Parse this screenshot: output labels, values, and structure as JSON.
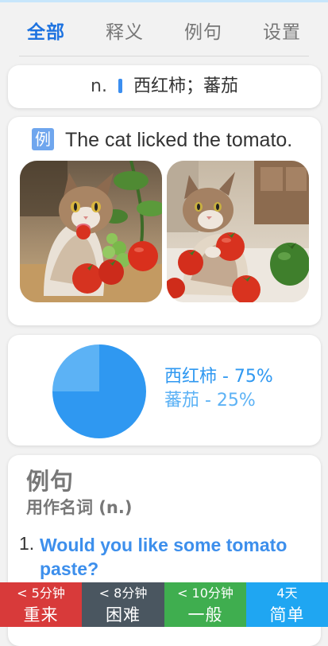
{
  "tabs": [
    {
      "label": "全部",
      "active": true
    },
    {
      "label": "释义",
      "active": false
    },
    {
      "label": "例句",
      "active": false
    },
    {
      "label": "设置",
      "active": false
    }
  ],
  "definition": {
    "pos": "n.",
    "meaning": "西红柿；蕃茄"
  },
  "example": {
    "badge": "例",
    "sentence": "The cat licked the tomato.",
    "images": [
      {
        "name": "kitten-licking-tomato-image"
      },
      {
        "name": "kitten-holding-tomato-image"
      }
    ]
  },
  "chart_data": {
    "type": "pie",
    "categories": [
      "西红柿",
      "蕃茄"
    ],
    "values": [
      75,
      25
    ],
    "labels": [
      "西红柿 - 75%",
      "蕃茄 - 25%"
    ],
    "colors": [
      "#2f98f1",
      "#5cb2f5"
    ],
    "legend_position": "right"
  },
  "usage": {
    "title": "例句",
    "subtitle": "用作名词 (n.)",
    "items": [
      {
        "number": "1.",
        "sentence": "Would you like some tomato paste?"
      }
    ]
  },
  "grades": [
    {
      "interval": "< 5分钟",
      "label": "重来",
      "color": "#d83a3a"
    },
    {
      "interval": "< 8分钟",
      "label": "困难",
      "color": "#4a5660"
    },
    {
      "interval": "< 10分钟",
      "label": "一般",
      "color": "#3fae4f"
    },
    {
      "interval": "4天",
      "label": "简单",
      "color": "#1fa6f2"
    }
  ]
}
